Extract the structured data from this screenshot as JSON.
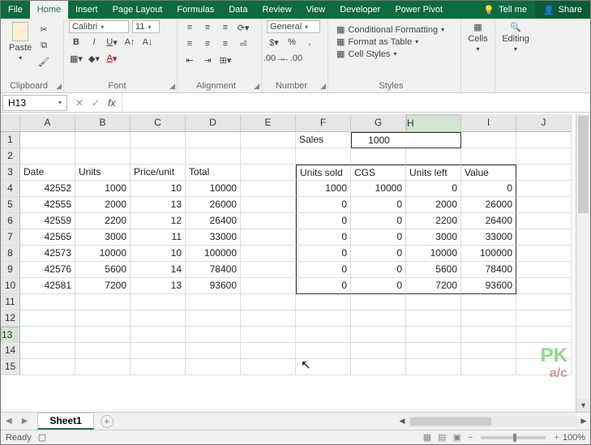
{
  "tabs": {
    "file": "File",
    "home": "Home",
    "insert": "Insert",
    "pagelayout": "Page Layout",
    "formulas": "Formulas",
    "data": "Data",
    "review": "Review",
    "view": "View",
    "developer": "Developer",
    "powerpivot": "Power Pivot",
    "tellme": "Tell me",
    "share": "Share"
  },
  "ribbon": {
    "clipboard": {
      "paste": "Paste",
      "label": "Clipboard"
    },
    "font": {
      "name": "Calibri",
      "size": "11",
      "label": "Font"
    },
    "alignment": {
      "label": "Alignment"
    },
    "number": {
      "format": "General",
      "label": "Number"
    },
    "styles": {
      "condfmt": "Conditional Formatting",
      "astable": "Format as Table",
      "cellstyles": "Cell Styles",
      "label": "Styles"
    },
    "cells": {
      "label": "Cells"
    },
    "editing": {
      "label": "Editing"
    }
  },
  "formula_bar": {
    "cell": "H13",
    "fx": "fx"
  },
  "columns": [
    "A",
    "B",
    "C",
    "D",
    "E",
    "F",
    "G",
    "H",
    "I",
    "J"
  ],
  "rownums": [
    "1",
    "2",
    "3",
    "4",
    "5",
    "6",
    "7",
    "8",
    "9",
    "10",
    "11",
    "12",
    "13",
    "14",
    "15"
  ],
  "chart_data": {
    "type": "table",
    "sales_label": "Sales",
    "sales_value": "1000",
    "left_headers": {
      "date": "Date",
      "units": "Units",
      "priceunit": "Price/unit",
      "total": "Total"
    },
    "right_headers": {
      "unitssold": "Units sold",
      "cgs": "CGS",
      "unitsleft": "Units left",
      "value": "Value"
    },
    "rows": [
      {
        "date": "42552",
        "units": "1000",
        "priceunit": "10",
        "total": "10000",
        "unitssold": "1000",
        "cgs": "10000",
        "unitsleft": "0",
        "value": "0"
      },
      {
        "date": "42555",
        "units": "2000",
        "priceunit": "13",
        "total": "26000",
        "unitssold": "0",
        "cgs": "0",
        "unitsleft": "2000",
        "value": "26000"
      },
      {
        "date": "42559",
        "units": "2200",
        "priceunit": "12",
        "total": "26400",
        "unitssold": "0",
        "cgs": "0",
        "unitsleft": "2200",
        "value": "26400"
      },
      {
        "date": "42565",
        "units": "3000",
        "priceunit": "11",
        "total": "33000",
        "unitssold": "0",
        "cgs": "0",
        "unitsleft": "3000",
        "value": "33000"
      },
      {
        "date": "42573",
        "units": "10000",
        "priceunit": "10",
        "total": "100000",
        "unitssold": "0",
        "cgs": "0",
        "unitsleft": "10000",
        "value": "100000"
      },
      {
        "date": "42576",
        "units": "5600",
        "priceunit": "14",
        "total": "78400",
        "unitssold": "0",
        "cgs": "0",
        "unitsleft": "5600",
        "value": "78400"
      },
      {
        "date": "42581",
        "units": "7200",
        "priceunit": "13",
        "total": "93600",
        "unitssold": "0",
        "cgs": "0",
        "unitsleft": "7200",
        "value": "93600"
      }
    ]
  },
  "sheet": {
    "name": "Sheet1"
  },
  "status": {
    "ready": "Ready",
    "zoom": "100%"
  }
}
